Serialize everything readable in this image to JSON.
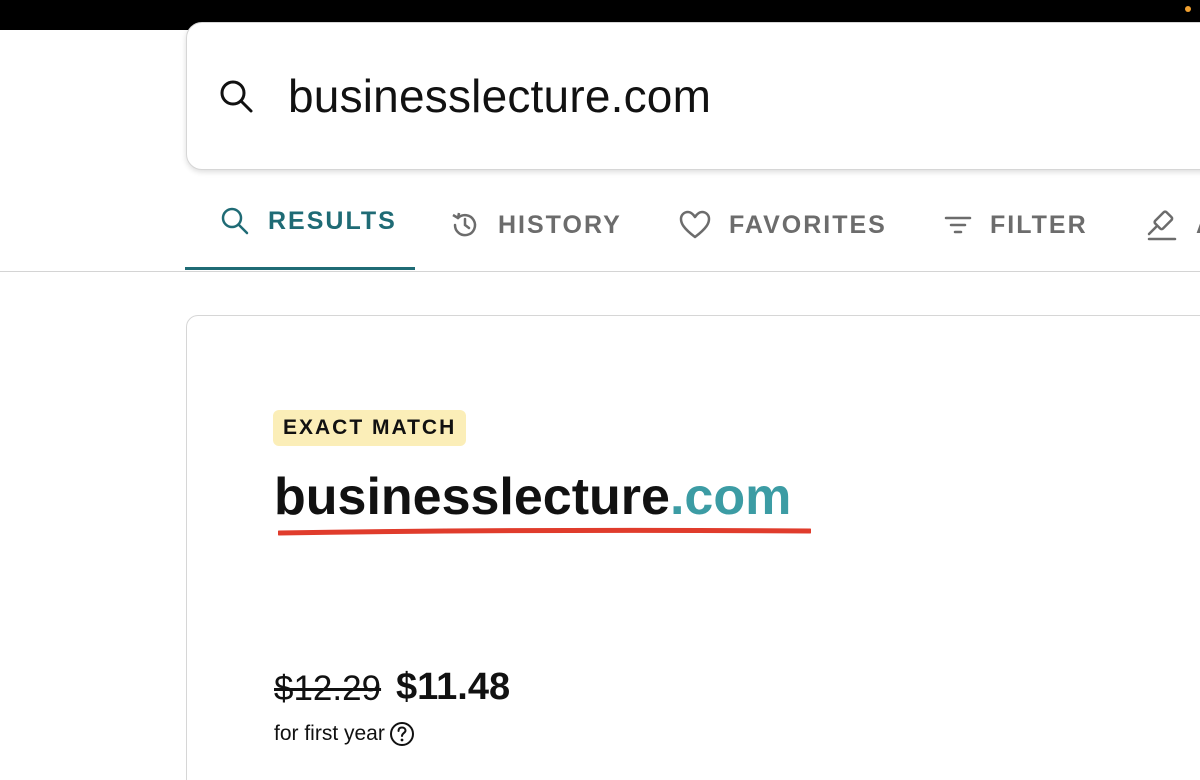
{
  "search": {
    "query": "businesslecture.com",
    "icon": "search-icon"
  },
  "tabs": [
    {
      "label": "RESULTS",
      "icon": "search-icon",
      "active": true
    },
    {
      "label": "HISTORY",
      "icon": "history-icon",
      "active": false
    },
    {
      "label": "FAVORITES",
      "icon": "heart-icon",
      "active": false
    },
    {
      "label": "FILTER",
      "icon": "filter-icon",
      "active": false
    },
    {
      "label": "A",
      "icon": "gavel-icon",
      "active": false
    }
  ],
  "result": {
    "badge": "EXACT MATCH",
    "domain_name": "businesslecture",
    "domain_tld": ".com",
    "old_price": "$12.29",
    "new_price": "$11.48",
    "price_note": "for first year"
  },
  "colors": {
    "accent": "#1f6b75",
    "tld": "#3c9ca4",
    "badge_bg": "#fbeeb8",
    "underline": "#e03c2c"
  }
}
